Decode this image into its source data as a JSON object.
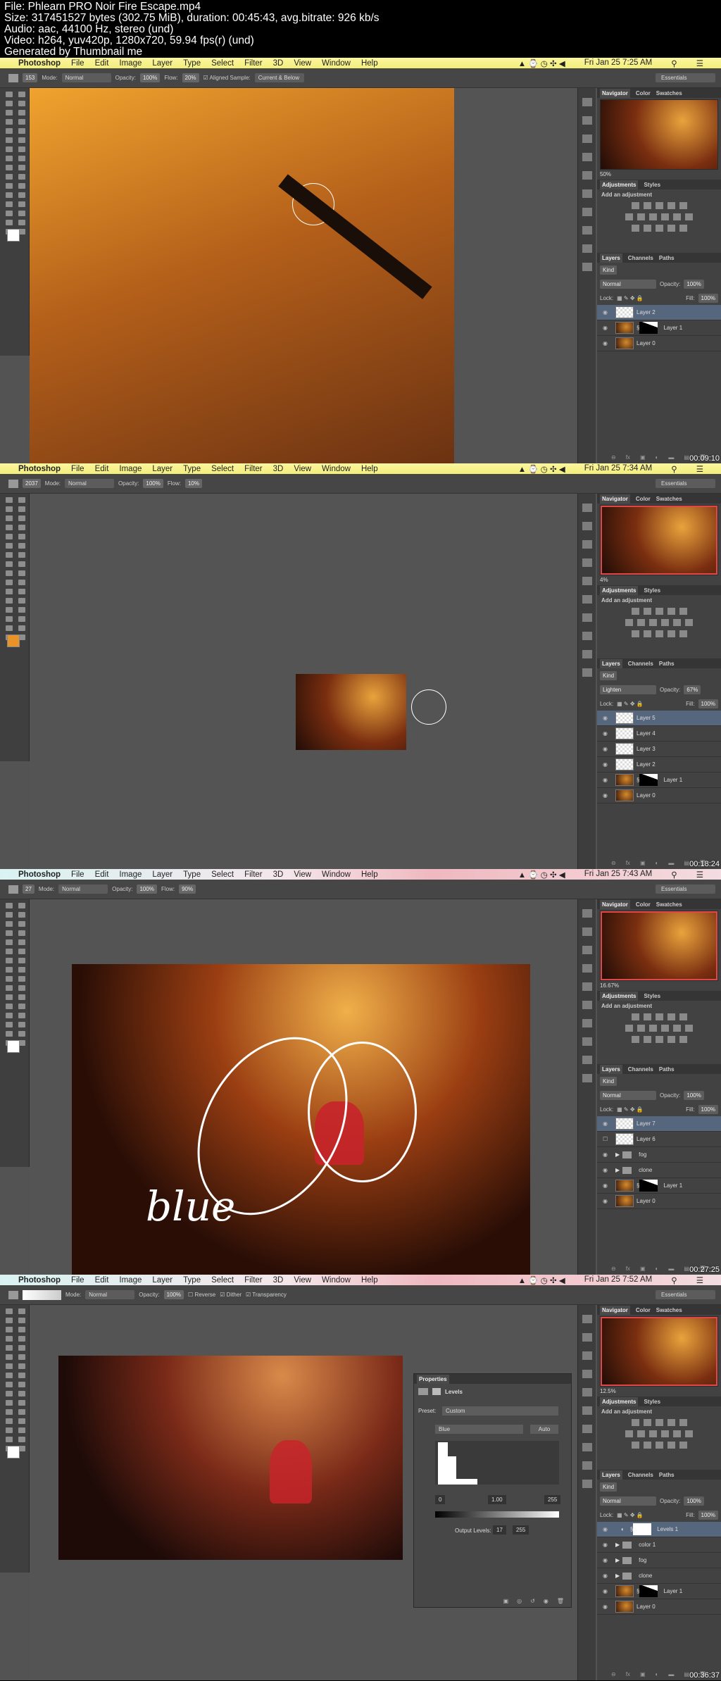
{
  "header": {
    "lines": [
      "File: Phlearn PRO Noir Fire Escape.mp4",
      "Size: 317451527 bytes (302.75 MiB), duration: 00:45:43, avg.bitrate: 926 kb/s",
      "Audio: aac, 44100 Hz, stereo (und)",
      "Video: h264, yuv420p, 1280x720, 59.94 fps(r) (und)",
      "Generated by Thumbnail me"
    ]
  },
  "menu": {
    "app": "Photoshop",
    "items": [
      "File",
      "Edit",
      "Image",
      "Layer",
      "Type",
      "Select",
      "Filter",
      "3D",
      "View",
      "Window",
      "Help"
    ]
  },
  "workspace": "Essentials",
  "panels": {
    "navigator_tabs": [
      "Navigator",
      "Color",
      "Swatches"
    ],
    "adjust_tabs": [
      "Adjustments",
      "Styles"
    ],
    "add_adjustment": "Add an adjustment",
    "layer_tabs": [
      "Layers",
      "Channels",
      "Paths"
    ],
    "kind": "Kind",
    "opacity_label": "Opacity:",
    "lock_label": "Lock:",
    "fill_label": "Fill:"
  },
  "frames": [
    {
      "time": "Fri Jan 25  7:25 AM",
      "timestamp": "00:09:10",
      "theme": "yellow",
      "options": {
        "brush_size": "153",
        "mode_label": "Mode:",
        "mode": "Normal",
        "opacity_label": "Opacity:",
        "opacity": "100%",
        "flow_label": "Flow:",
        "flow": "20%",
        "aligned": "Aligned Sample:",
        "sample": "Current & Below"
      },
      "nav_zoom": "50%",
      "blend": "Normal",
      "opacity": "100%",
      "fill": "100%",
      "fg_color": "#ffffff",
      "layers": [
        {
          "name": "Layer 2",
          "type": "empty",
          "selected": true,
          "visible": true
        },
        {
          "name": "Layer 1",
          "type": "photo-mask",
          "visible": true
        },
        {
          "name": "Layer 0",
          "type": "photo",
          "visible": true
        }
      ]
    },
    {
      "time": "Fri Jan 25  7:34 AM",
      "timestamp": "00:18:24",
      "theme": "yellow",
      "options": {
        "brush_size": "2037",
        "mode_label": "Mode:",
        "mode": "Normal",
        "opacity_label": "Opacity:",
        "opacity": "100%",
        "flow_label": "Flow:",
        "flow": "10%"
      },
      "nav_zoom": "4%",
      "blend": "Lighten",
      "opacity": "67%",
      "fill": "100%",
      "fg_color": "#e8922a",
      "layers": [
        {
          "name": "Layer 5",
          "type": "empty",
          "selected": true,
          "visible": true
        },
        {
          "name": "Layer 4",
          "type": "empty",
          "visible": true
        },
        {
          "name": "Layer 3",
          "type": "empty",
          "visible": true
        },
        {
          "name": "Layer 2",
          "type": "empty",
          "visible": true
        },
        {
          "name": "Layer 1",
          "type": "photo-mask",
          "visible": true
        },
        {
          "name": "Layer 0",
          "type": "photo",
          "visible": true
        }
      ]
    },
    {
      "time": "Fri Jan 25  7:43 AM",
      "timestamp": "00:27:25",
      "theme": "pink",
      "options": {
        "brush_size": "27",
        "mode_label": "Mode:",
        "mode": "Normal",
        "opacity_label": "Opacity:",
        "opacity": "100%",
        "flow_label": "Flow:",
        "flow": "90%"
      },
      "nav_zoom": "16.67%",
      "blend": "Normal",
      "opacity": "100%",
      "fill": "100%",
      "fg_color": "#ffffff",
      "annotation": "blue",
      "layers": [
        {
          "name": "Layer 7",
          "type": "empty",
          "selected": true,
          "visible": true
        },
        {
          "name": "Layer 6",
          "type": "empty",
          "visible": false
        },
        {
          "name": "fog",
          "type": "folder",
          "visible": true
        },
        {
          "name": "clone",
          "type": "folder",
          "visible": true
        },
        {
          "name": "Layer 1",
          "type": "photo-mask",
          "visible": true
        },
        {
          "name": "Layer 0",
          "type": "photo",
          "visible": true
        }
      ]
    },
    {
      "time": "Fri Jan 25  7:52 AM",
      "timestamp": "00:36:37",
      "theme": "pink",
      "options": {
        "mode_label": "Mode:",
        "mode": "Normal",
        "opacity_label": "Opacity:",
        "opacity": "100%",
        "reverse": "Reverse",
        "dither": "Dither",
        "transparency": "Transparency"
      },
      "nav_zoom": "12.5%",
      "blend": "Normal",
      "opacity": "100%",
      "fill": "100%",
      "fg_color": "#ffffff",
      "properties": {
        "title": "Properties",
        "type": "Levels",
        "preset_label": "Preset:",
        "preset": "Custom",
        "channel": "Blue",
        "auto": "Auto",
        "input_black": "0",
        "input_gamma": "1.00",
        "input_white": "255",
        "output_label": "Output Levels:",
        "output_black": "17",
        "output_white": "255"
      },
      "layers": [
        {
          "name": "Levels 1",
          "type": "adjust-mask",
          "selected": true,
          "visible": true
        },
        {
          "name": "color 1",
          "type": "folder",
          "visible": true
        },
        {
          "name": "fog",
          "type": "folder",
          "visible": true
        },
        {
          "name": "clone",
          "type": "folder",
          "visible": true
        },
        {
          "name": "Layer 1",
          "type": "photo-mask",
          "visible": true
        },
        {
          "name": "Layer 0",
          "type": "photo",
          "visible": true
        }
      ]
    }
  ]
}
